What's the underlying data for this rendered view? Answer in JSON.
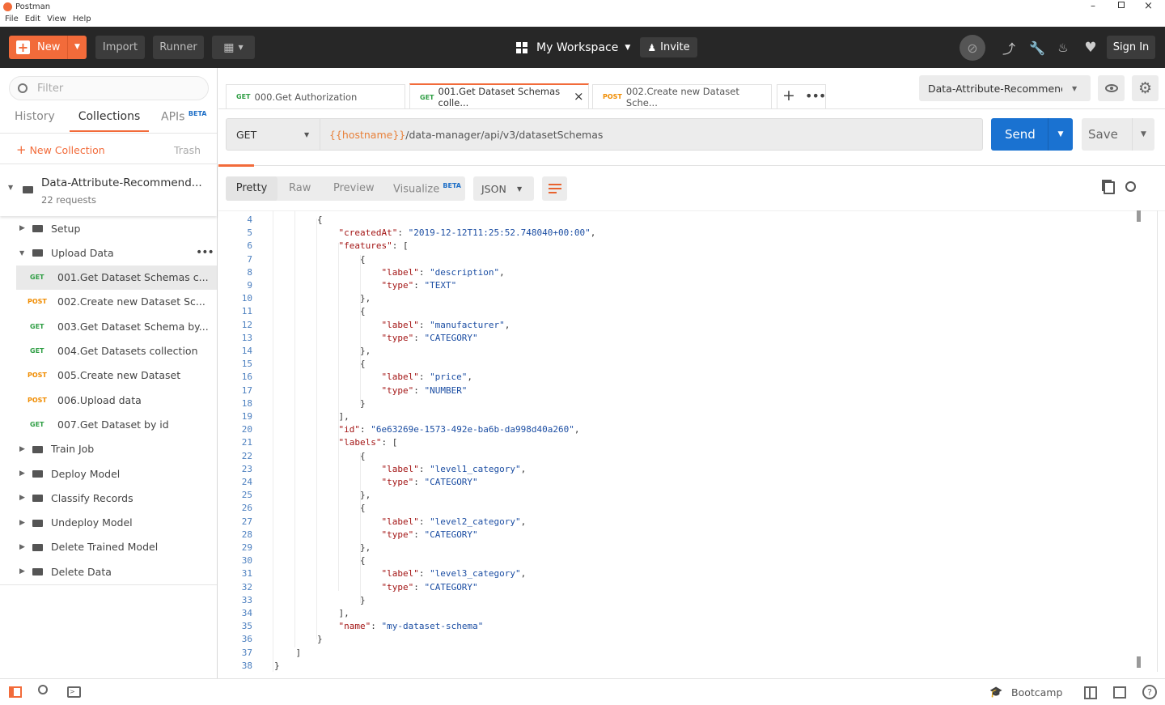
{
  "window": {
    "title": "Postman"
  },
  "menu": [
    "File",
    "Edit",
    "View",
    "Help"
  ],
  "topbar": {
    "new_label": "New",
    "import_label": "Import",
    "runner_label": "Runner",
    "workspace_label": "My Workspace",
    "invite_label": "Invite",
    "signin_label": "Sign In",
    "accent": "#f26b3a"
  },
  "sidebar": {
    "filter_placeholder": "Filter",
    "tabs": {
      "history": "History",
      "collections": "Collections",
      "apis": "APIs",
      "apis_badge": "BETA"
    },
    "new_collection": "New Collection",
    "trash": "Trash",
    "collection": {
      "name": "Data-Attribute-Recommend...",
      "count": "22 requests"
    },
    "folders_before": [
      {
        "label": "Setup"
      }
    ],
    "open_folder": {
      "label": "Upload Data"
    },
    "requests": [
      {
        "method": "GET",
        "label": "001.Get Dataset Schemas c..."
      },
      {
        "method": "POST",
        "label": "002.Create new Dataset Sc..."
      },
      {
        "method": "GET",
        "label": "003.Get Dataset Schema by..."
      },
      {
        "method": "GET",
        "label": "004.Get Datasets collection"
      },
      {
        "method": "POST",
        "label": "005.Create new Dataset"
      },
      {
        "method": "POST",
        "label": "006.Upload data"
      },
      {
        "method": "GET",
        "label": "007.Get Dataset by id"
      }
    ],
    "folders_after": [
      {
        "label": "Train Job"
      },
      {
        "label": "Deploy Model"
      },
      {
        "label": "Classify Records"
      },
      {
        "label": "Undeploy Model"
      },
      {
        "label": "Delete Trained Model"
      },
      {
        "label": "Delete Data"
      }
    ]
  },
  "tabs": [
    {
      "method": "GET",
      "label": "000.Get Authorization"
    },
    {
      "method": "GET",
      "label": "001.Get Dataset Schemas colle..."
    },
    {
      "method": "POST",
      "label": "002.Create new Dataset Sche..."
    }
  ],
  "environment": {
    "selected": "Data-Attribute-Recommend:"
  },
  "request": {
    "method": "GET",
    "url_var": "{{hostname}}",
    "url_path": "/data-manager/api/v3/datasetSchemas",
    "send_label": "Send",
    "save_label": "Save"
  },
  "response": {
    "view_tabs": {
      "pretty": "Pretty",
      "raw": "Raw",
      "preview": "Preview",
      "visualize": "Visualize",
      "visualize_badge": "BETA"
    },
    "format": "JSON",
    "lines": [
      {
        "n": "4",
        "t": "        {"
      },
      {
        "n": "5",
        "t": "            \"createdAt\": \"2019-12-12T11:25:52.748040+00:00\","
      },
      {
        "n": "6",
        "t": "            \"features\": ["
      },
      {
        "n": "7",
        "t": "                {"
      },
      {
        "n": "8",
        "t": "                    \"label\": \"description\","
      },
      {
        "n": "9",
        "t": "                    \"type\": \"TEXT\""
      },
      {
        "n": "10",
        "t": "                },"
      },
      {
        "n": "11",
        "t": "                {"
      },
      {
        "n": "12",
        "t": "                    \"label\": \"manufacturer\","
      },
      {
        "n": "13",
        "t": "                    \"type\": \"CATEGORY\""
      },
      {
        "n": "14",
        "t": "                },"
      },
      {
        "n": "15",
        "t": "                {"
      },
      {
        "n": "16",
        "t": "                    \"label\": \"price\","
      },
      {
        "n": "17",
        "t": "                    \"type\": \"NUMBER\""
      },
      {
        "n": "18",
        "t": "                }"
      },
      {
        "n": "19",
        "t": "            ],"
      },
      {
        "n": "20",
        "t": "            \"id\": \"6e63269e-1573-492e-ba6b-da998d40a260\","
      },
      {
        "n": "21",
        "t": "            \"labels\": ["
      },
      {
        "n": "22",
        "t": "                {"
      },
      {
        "n": "23",
        "t": "                    \"label\": \"level1_category\","
      },
      {
        "n": "24",
        "t": "                    \"type\": \"CATEGORY\""
      },
      {
        "n": "25",
        "t": "                },"
      },
      {
        "n": "26",
        "t": "                {"
      },
      {
        "n": "27",
        "t": "                    \"label\": \"level2_category\","
      },
      {
        "n": "28",
        "t": "                    \"type\": \"CATEGORY\""
      },
      {
        "n": "29",
        "t": "                },"
      },
      {
        "n": "30",
        "t": "                {"
      },
      {
        "n": "31",
        "t": "                    \"label\": \"level3_category\","
      },
      {
        "n": "32",
        "t": "                    \"type\": \"CATEGORY\""
      },
      {
        "n": "33",
        "t": "                }"
      },
      {
        "n": "34",
        "t": "            ],"
      },
      {
        "n": "35",
        "t": "            \"name\": \"my-dataset-schema\""
      },
      {
        "n": "36",
        "t": "        }"
      },
      {
        "n": "37",
        "t": "    ]"
      },
      {
        "n": "38",
        "t": "}"
      }
    ]
  },
  "footer": {
    "bootcamp": "Bootcamp"
  }
}
